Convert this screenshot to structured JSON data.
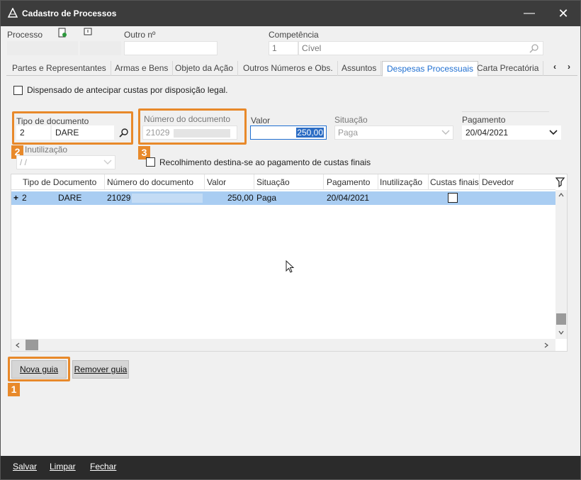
{
  "window": {
    "title": "Cadastro de Processos",
    "minimize": "—",
    "close": "✕"
  },
  "header": {
    "processo_label": "Processo",
    "outro_label": "Outro nº",
    "competencia_label": "Competência",
    "competencia_code": "1",
    "competencia_value": "Cível"
  },
  "tabs": [
    "Partes e Representantes",
    "Armas e Bens",
    "Objeto da Ação",
    "Outros Números e Obs.",
    "Assuntos",
    "Despesas Processuais",
    "Carta Precatória"
  ],
  "tab_nav": {
    "prev": "‹",
    "next": "›"
  },
  "form": {
    "dispensado_label": "Dispensado de antecipar custas por disposição legal.",
    "tipo_doc_label": "Tipo de documento",
    "tipo_doc_code": "2",
    "tipo_doc_value": "DARE",
    "numero_doc_label": "Número do documento",
    "numero_doc_value": "21029",
    "valor_label": "Valor",
    "valor_value": "250,00",
    "situacao_label": "Situação",
    "situacao_value": "Paga",
    "pagamento_label": "Pagamento",
    "pagamento_value": "20/04/2021",
    "inutilizacao_label": "Inutilização",
    "inutilizacao_value": "/ /",
    "recolhimento_label": "Recolhimento destina-se ao pagamento de custas finais"
  },
  "grid": {
    "columns": [
      "Tipo de Documento",
      "Número do documento",
      "Valor",
      "Situação",
      "Pagamento",
      "Inutilização",
      "Custas finais",
      "Devedor"
    ],
    "rows": [
      {
        "expand": "+",
        "code": "2",
        "tipo": "DARE",
        "numero": "21029",
        "valor": "250,00",
        "situacao": "Paga",
        "pagamento": "20/04/2021"
      }
    ]
  },
  "buttons": {
    "nova_guia": "Nova guia",
    "remover_guia": "Remover guia"
  },
  "callouts": [
    "1",
    "2",
    "3"
  ],
  "footer": {
    "salvar": "Salvar",
    "limpar": "Limpar",
    "fechar": "Fechar"
  },
  "colors": {
    "accent": "#e8892a",
    "selection": "#a9cdf2",
    "tab_active": "#1f6fd1",
    "titlebar": "#3c3c3c"
  }
}
